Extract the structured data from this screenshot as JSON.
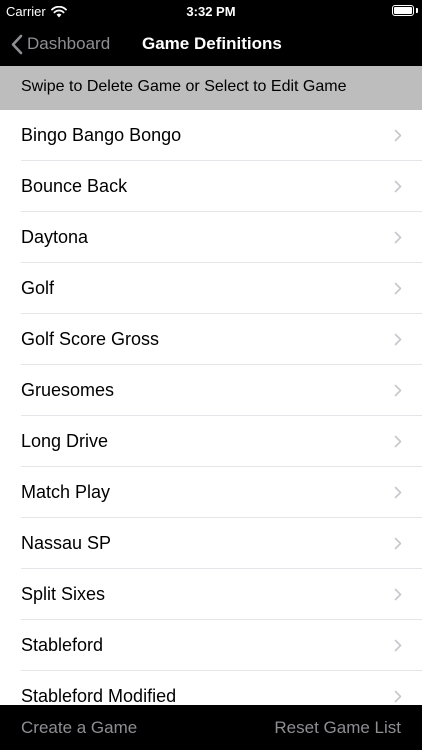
{
  "status_bar": {
    "carrier": "Carrier",
    "time": "3:32 PM"
  },
  "nav": {
    "back_label": "Dashboard",
    "title": "Game Definitions"
  },
  "instruction": "Swipe to Delete Game or Select to Edit Game",
  "games": [
    "Bingo Bango Bongo",
    "Bounce Back",
    "Daytona",
    "Golf",
    "Golf Score Gross",
    "Gruesomes",
    "Long Drive",
    "Match Play",
    "Nassau SP",
    "Split Sixes",
    "Stableford",
    "Stableford Modified"
  ],
  "toolbar": {
    "create_label": "Create a Game",
    "reset_label": "Reset Game List"
  },
  "icons": {
    "wifi": "wifi-icon",
    "battery": "battery-icon",
    "back": "chevron-left-icon",
    "disclosure": "chevron-right-icon"
  },
  "colors": {
    "bar_background": "#000000",
    "banner_background": "#bdbdbd",
    "muted_text": "#8e8e93",
    "chevron": "#c7c7cc"
  }
}
